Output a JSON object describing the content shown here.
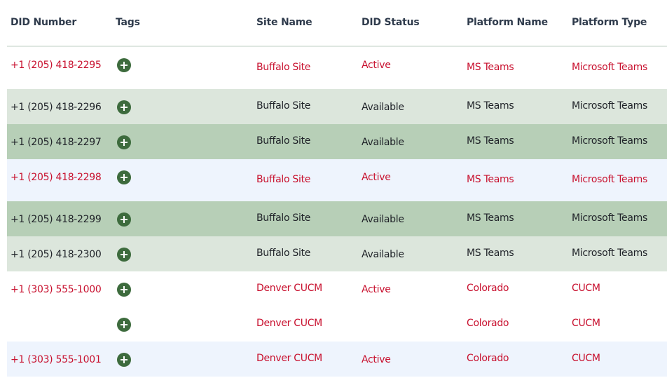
{
  "columns": {
    "did_number": "DID Number",
    "tags": "Tags",
    "site_name": "Site Name",
    "did_status": "DID Status",
    "platform_name": "Platform Name",
    "platform_type": "Platform Type"
  },
  "tag_add_icon": "plus-circle-icon",
  "colors": {
    "active_text": "#c8102e",
    "default_text": "#1f2228",
    "add_button": "#3d6b3d",
    "row_light_green": "#dce6dc",
    "row_green": "#b7cfb7",
    "row_light_blue": "#eef4fd"
  },
  "rows": [
    {
      "did": "+1 (205) 418-2295",
      "site": "Buffalo Site",
      "status": "Active",
      "platform_name": "MS Teams",
      "platform_type": "Microsoft Teams"
    },
    {
      "did": "+1 (205) 418-2296",
      "site": "Buffalo Site",
      "status": "Available",
      "platform_name": "MS Teams",
      "platform_type": "Microsoft Teams"
    },
    {
      "did": "+1 (205) 418-2297",
      "site": "Buffalo Site",
      "status": "Available",
      "platform_name": "MS Teams",
      "platform_type": "Microsoft Teams"
    },
    {
      "did": "+1 (205) 418-2298",
      "site": "Buffalo Site",
      "status": "Active",
      "platform_name": "MS Teams",
      "platform_type": "Microsoft Teams"
    },
    {
      "did": "+1 (205) 418-2299",
      "site": "Buffalo Site",
      "status": "Available",
      "platform_name": "MS Teams",
      "platform_type": "Microsoft Teams"
    },
    {
      "did": "+1 (205) 418-2300",
      "site": "Buffalo Site",
      "status": "Available",
      "platform_name": "MS Teams",
      "platform_type": "Microsoft Teams"
    },
    {
      "did": "+1 (303) 555-1000",
      "site": "Denver CUCM",
      "status": "Active",
      "platform_name": "Colorado",
      "platform_type": "CUCM"
    },
    {
      "did": "",
      "site": "Denver CUCM",
      "status": "",
      "platform_name": "Colorado",
      "platform_type": "CUCM"
    },
    {
      "did": "+1 (303) 555-1001",
      "site": "Denver CUCM",
      "status": "Active",
      "platform_name": "Colorado",
      "platform_type": "CUCM"
    }
  ]
}
